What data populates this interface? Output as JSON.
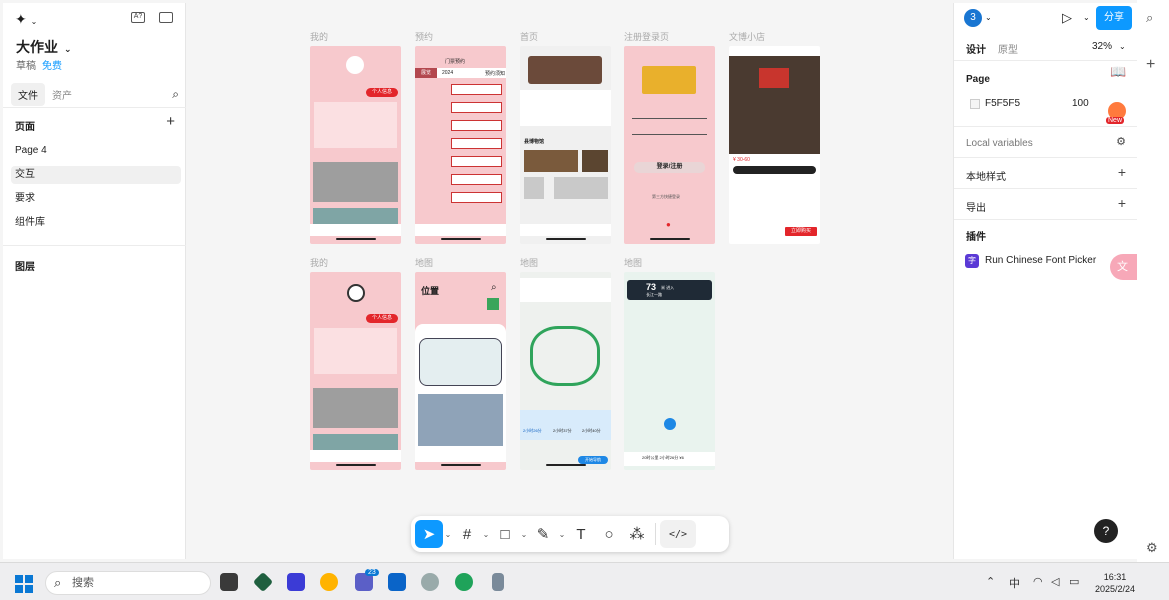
{
  "left_panel": {
    "project_title": "大作业",
    "project_chev": "⌄",
    "drafts": "草稿",
    "plan": "免费",
    "tabs": [
      "文件",
      "资产"
    ],
    "pages_header": "页面",
    "pages": [
      "Page 4",
      "交互",
      "要求",
      "组件库"
    ],
    "layers_header": "图层"
  },
  "canvas": {
    "frame_labels_row1": [
      "我的",
      "预约",
      "首页",
      "注册登录页",
      "文博小店"
    ],
    "frame_labels_row2": [
      "我的",
      "地图",
      "地图",
      "地图"
    ],
    "frame_texts": {
      "personal_info": "个人信息",
      "reservation_header": "门票预约",
      "reservation_tabs": [
        "展览",
        "2024",
        "预约须知"
      ],
      "login_button": "登录/注册",
      "third_party": "第三方快捷登录",
      "live": "县博物馆",
      "location_title": "位置",
      "map_eta": "73",
      "map_eta_unit": "米 进入",
      "map_road": "长江一路",
      "route_times": [
        "2小时26分",
        "2小时37分",
        "2小时40分"
      ],
      "shop_price": "¥ 30-60",
      "buy_button": "立即购买",
      "start_nav": "开始导航",
      "trip_summary": "20时公里 2小时26分 ¥6"
    }
  },
  "toolbar": {
    "tools": [
      "move-tool",
      "frame-tool",
      "shape-tool",
      "pen-tool",
      "text-tool",
      "comment-tool",
      "actions-tool",
      "dev-mode"
    ]
  },
  "right_panel": {
    "user_initial": "3",
    "share": "分享",
    "tabs": [
      "设计",
      "原型"
    ],
    "zoom": "32%",
    "page_section": "Page",
    "page_color": "F5F5F5",
    "page_opacity": "100",
    "local_variables": "Local variables",
    "local_styles": "本地样式",
    "export": "导出",
    "plugins": "插件",
    "plugin_name": "Run Chinese Font Picker",
    "plugin_icon_text": "字",
    "help": "?",
    "new_badge": "New"
  },
  "taskbar": {
    "search": "搜索",
    "badge": "23",
    "ime": "中",
    "time": "16:31",
    "date": "2025/2/24"
  },
  "colors": {
    "accent": "#0d99ff",
    "frame_pink": "#f7c9cd",
    "red_button": "#e3262b"
  }
}
